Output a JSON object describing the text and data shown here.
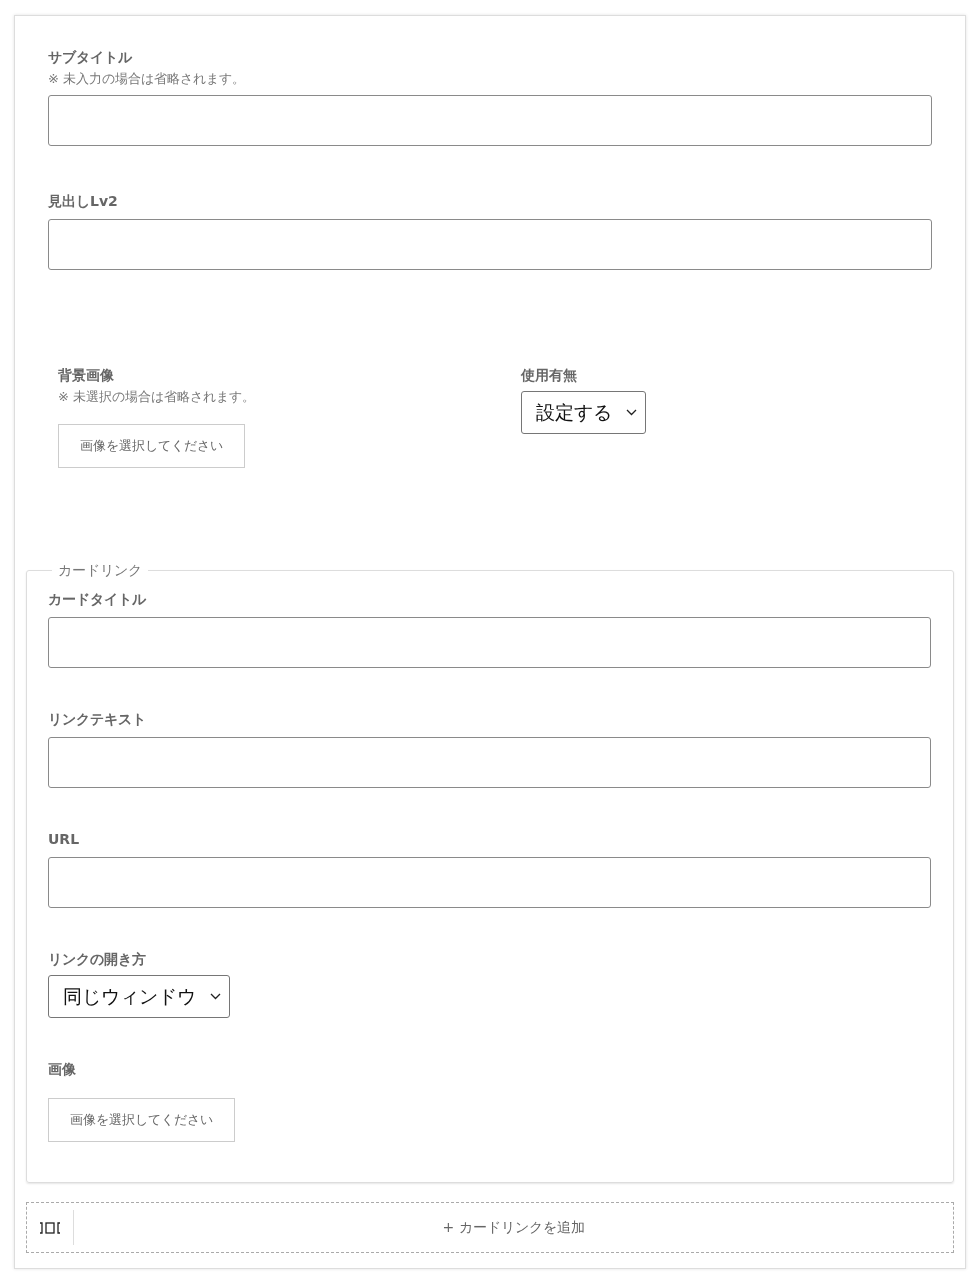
{
  "fields": [
    {
      "kind": "text",
      "label": "サブタイトル",
      "note": "※ 未入力の場合は省略されます。"
    },
    {
      "kind": "text",
      "label": "見出しLv2"
    }
  ],
  "background": [
    {
      "kind": "image",
      "label": "背景画像",
      "note": "※ 未選択の場合は省略されます。",
      "button": "画像を選択してください"
    },
    {
      "kind": "select",
      "label": "使用有無",
      "value": "設定する"
    }
  ],
  "card_link": {
    "legend": "カードリンク",
    "fields": [
      {
        "kind": "text",
        "label": "カードタイトル"
      },
      {
        "kind": "text",
        "label": "リンクテキスト"
      },
      {
        "kind": "text",
        "label": "URL"
      },
      {
        "kind": "select",
        "label": "リンクの開き方",
        "value": "同じウィンドウ"
      },
      {
        "kind": "image",
        "label": "画像",
        "button": "画像を選択してください"
      }
    ]
  },
  "add_button": "+ カードリンクを追加"
}
